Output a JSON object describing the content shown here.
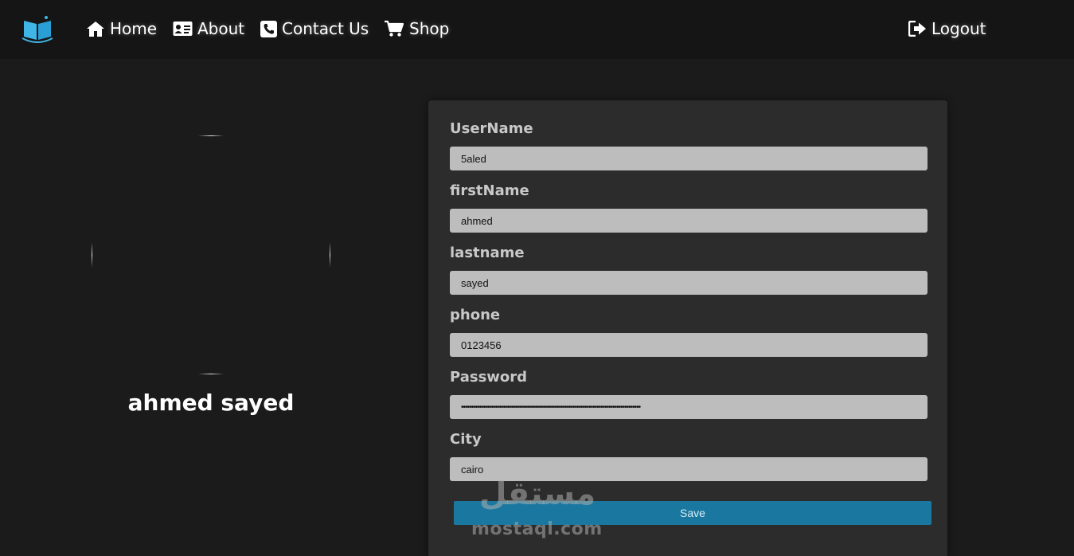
{
  "nav": {
    "home": "Home",
    "about": "About",
    "contact": "Contact Us",
    "shop": "Shop",
    "logout": "Logout"
  },
  "icons": {
    "logo": "open-book-icon",
    "home": "home-icon",
    "about": "id-card-icon",
    "contact": "phone-icon",
    "shop": "cart-icon",
    "logout": "sign-out-icon"
  },
  "profile": {
    "name": "ahmed sayed"
  },
  "form": {
    "fields": [
      {
        "label": "UserName",
        "value": "5aled"
      },
      {
        "label": "firstName",
        "value": "ahmed"
      },
      {
        "label": "lastname",
        "value": "sayed"
      },
      {
        "label": "phone",
        "value": "0123456"
      },
      {
        "label": "Password",
        "value": "••••••••••••••••••••••••••••••••••••••••••••••••••••••••••••••••••••••••••••••••••••••••••"
      },
      {
        "label": "City",
        "value": "cairo"
      }
    ],
    "save_label": "Save"
  },
  "watermark": {
    "arabic": "مستقل",
    "url": "mostaql.com"
  },
  "colors": {
    "navbar_bg": "#151515",
    "page_bg": "#1b1b1b",
    "card_bg": "#2c2c2c",
    "input_bg": "#bdbdbd",
    "save_button": "#1a78a0",
    "logo_blue": "#3fb6e6"
  }
}
